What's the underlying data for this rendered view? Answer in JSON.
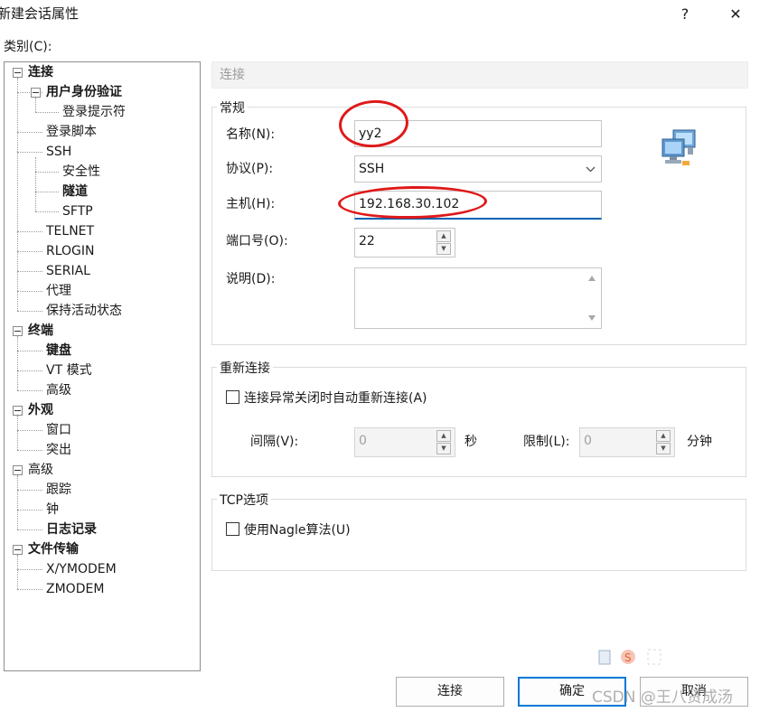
{
  "window": {
    "title": "新建会话属性",
    "help_label": "?",
    "close_label": "✕"
  },
  "category_label": "类别(C):",
  "tree": [
    {
      "label": "连接",
      "bold": true
    },
    {
      "label": "用户身份验证",
      "bold": true
    },
    {
      "label": "登录提示符",
      "bold": false
    },
    {
      "label": "登录脚本",
      "bold": false
    },
    {
      "label": "SSH",
      "bold": false
    },
    {
      "label": "安全性",
      "bold": false
    },
    {
      "label": "隧道",
      "bold": true
    },
    {
      "label": "SFTP",
      "bold": false
    },
    {
      "label": "TELNET",
      "bold": false
    },
    {
      "label": "RLOGIN",
      "bold": false
    },
    {
      "label": "SERIAL",
      "bold": false
    },
    {
      "label": "代理",
      "bold": false
    },
    {
      "label": "保持活动状态",
      "bold": false
    },
    {
      "label": "终端",
      "bold": true
    },
    {
      "label": "键盘",
      "bold": true
    },
    {
      "label": "VT 模式",
      "bold": false
    },
    {
      "label": "高级",
      "bold": false
    },
    {
      "label": "外观",
      "bold": true
    },
    {
      "label": "窗口",
      "bold": false
    },
    {
      "label": "突出",
      "bold": false
    },
    {
      "label": "高级",
      "bold": false
    },
    {
      "label": "跟踪",
      "bold": false
    },
    {
      "label": "钟",
      "bold": false
    },
    {
      "label": "日志记录",
      "bold": true
    },
    {
      "label": "文件传输",
      "bold": true
    },
    {
      "label": "X/YMODEM",
      "bold": false
    },
    {
      "label": "ZMODEM",
      "bold": false
    }
  ],
  "page_header": "连接",
  "general": {
    "title": "常规",
    "name_label": "名称(N):",
    "name_value": "yy2",
    "protocol_label": "协议(P):",
    "protocol_value": "SSH",
    "host_label": "主机(H):",
    "host_value": "192.168.30.102",
    "port_label": "端口号(O):",
    "port_value": "22",
    "desc_label": "说明(D):",
    "desc_value": ""
  },
  "reconnect": {
    "title": "重新连接",
    "auto_label": "连接异常关闭时自动重新连接(A)",
    "auto_checked": false,
    "interval_label": "间隔(V):",
    "interval_value": "0",
    "interval_unit": "秒",
    "limit_label": "限制(L):",
    "limit_value": "0",
    "limit_unit": "分钟"
  },
  "tcp": {
    "title": "TCP选项",
    "nagle_label": "使用Nagle算法(U)",
    "nagle_checked": false
  },
  "buttons": {
    "connect": "连接",
    "ok": "确定",
    "cancel": "取消"
  },
  "watermark": "CSDN @王八贤成汤",
  "colors": {
    "annotation_red": "#e01818",
    "focus_blue": "#0063b1",
    "primary_border": "#0078d7"
  }
}
